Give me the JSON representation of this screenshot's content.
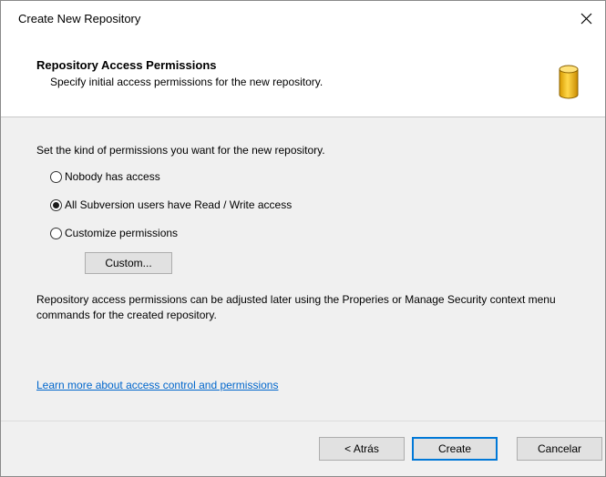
{
  "window": {
    "title": "Create New Repository"
  },
  "header": {
    "title": "Repository Access Permissions",
    "subtitle": "Specify initial access permissions for the new repository.",
    "icon": "database-cylinder-icon"
  },
  "content": {
    "prompt": "Set the kind of permissions you want for the new repository.",
    "options": [
      {
        "label": "Nobody has access",
        "checked": false
      },
      {
        "label": "All Subversion users have Read / Write access",
        "checked": true
      },
      {
        "label": "Customize permissions",
        "checked": false
      }
    ],
    "custom_button": "Custom...",
    "note": "Repository access permissions can be adjusted later using the Properies or Manage Security context menu commands for the created repository.",
    "link": "Learn more about access control and permissions"
  },
  "footer": {
    "back": "< Atrás",
    "create": "Create",
    "cancel": "Cancelar"
  },
  "colors": {
    "link": "#0066cc",
    "default_button_border": "#0078d7",
    "icon_gold": "#f2b705"
  }
}
